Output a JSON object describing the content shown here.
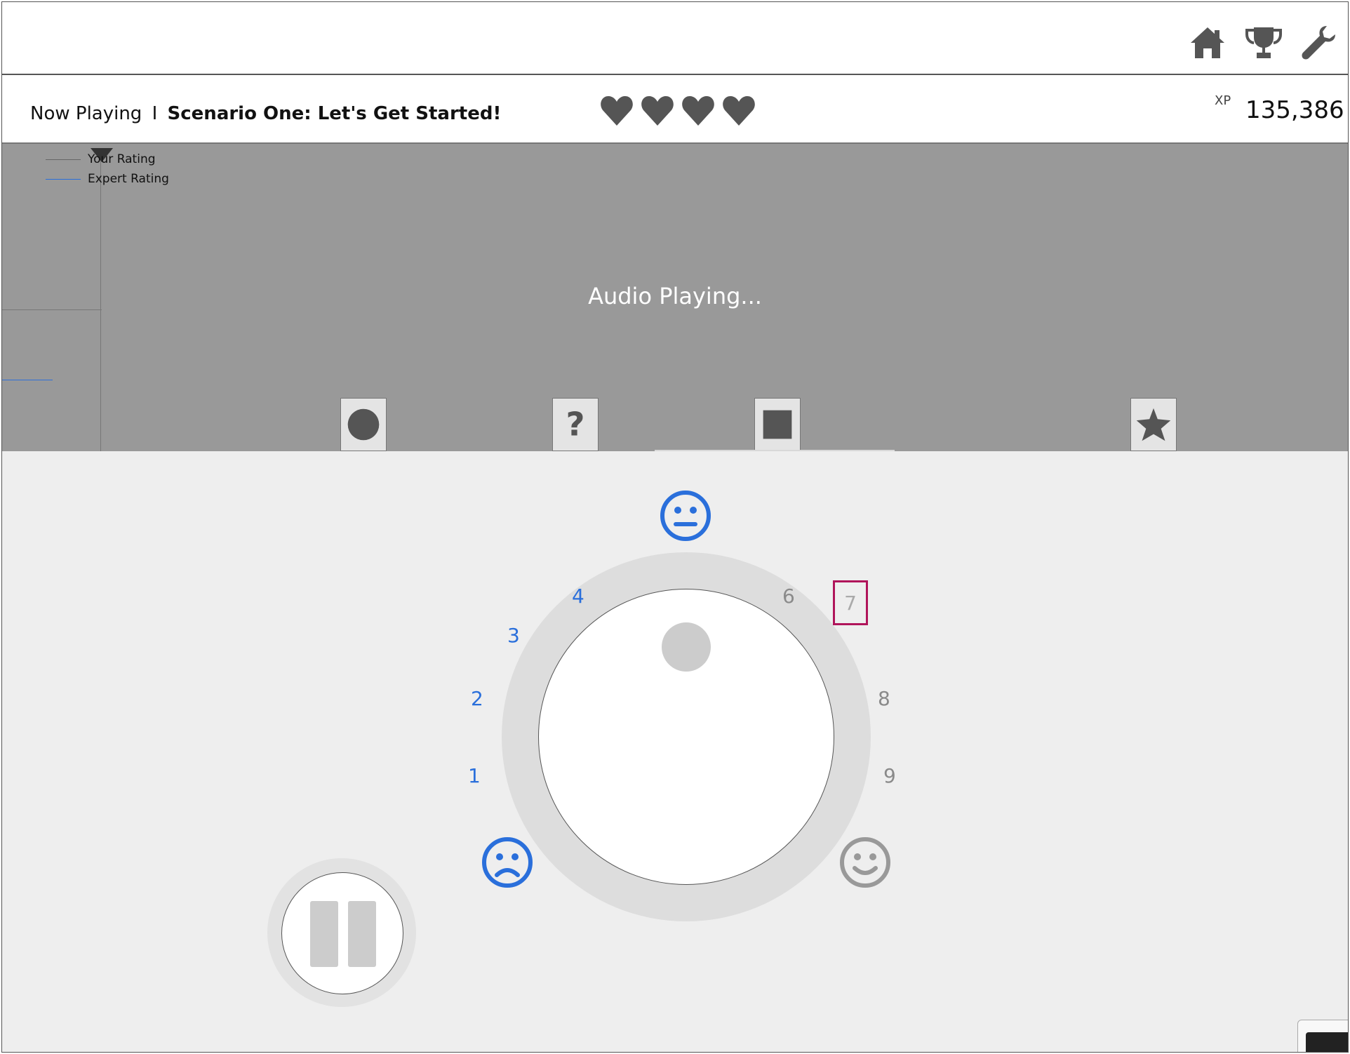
{
  "now_playing": {
    "prefix": "Now Playing",
    "separator": "I",
    "scenario": "Scenario One: Let's Get Started!"
  },
  "lives": {
    "count": 4,
    "icon": "heart-icon"
  },
  "xp": {
    "label": "XP",
    "value": "135,386"
  },
  "topnav": {
    "icons": [
      "home-icon",
      "trophy-icon",
      "wrench-icon"
    ]
  },
  "audio_panel": {
    "status": "Audio Playing..."
  },
  "legend": {
    "your_rating": "Your Rating",
    "expert_rating": "Expert Rating"
  },
  "track_buttons": [
    "circle-icon",
    "question-icon",
    "square-icon",
    "star-icon"
  ],
  "dial": {
    "numbers": [
      "1",
      "2",
      "3",
      "4",
      "6",
      "7",
      "8",
      "9"
    ],
    "highlighted": "7",
    "faces": [
      "sad-face-icon",
      "neutral-face-icon",
      "happy-face-icon"
    ]
  },
  "colors": {
    "accent_blue": "#2a6fdb",
    "highlight": "#b0145a",
    "panel_gray": "#999999"
  }
}
